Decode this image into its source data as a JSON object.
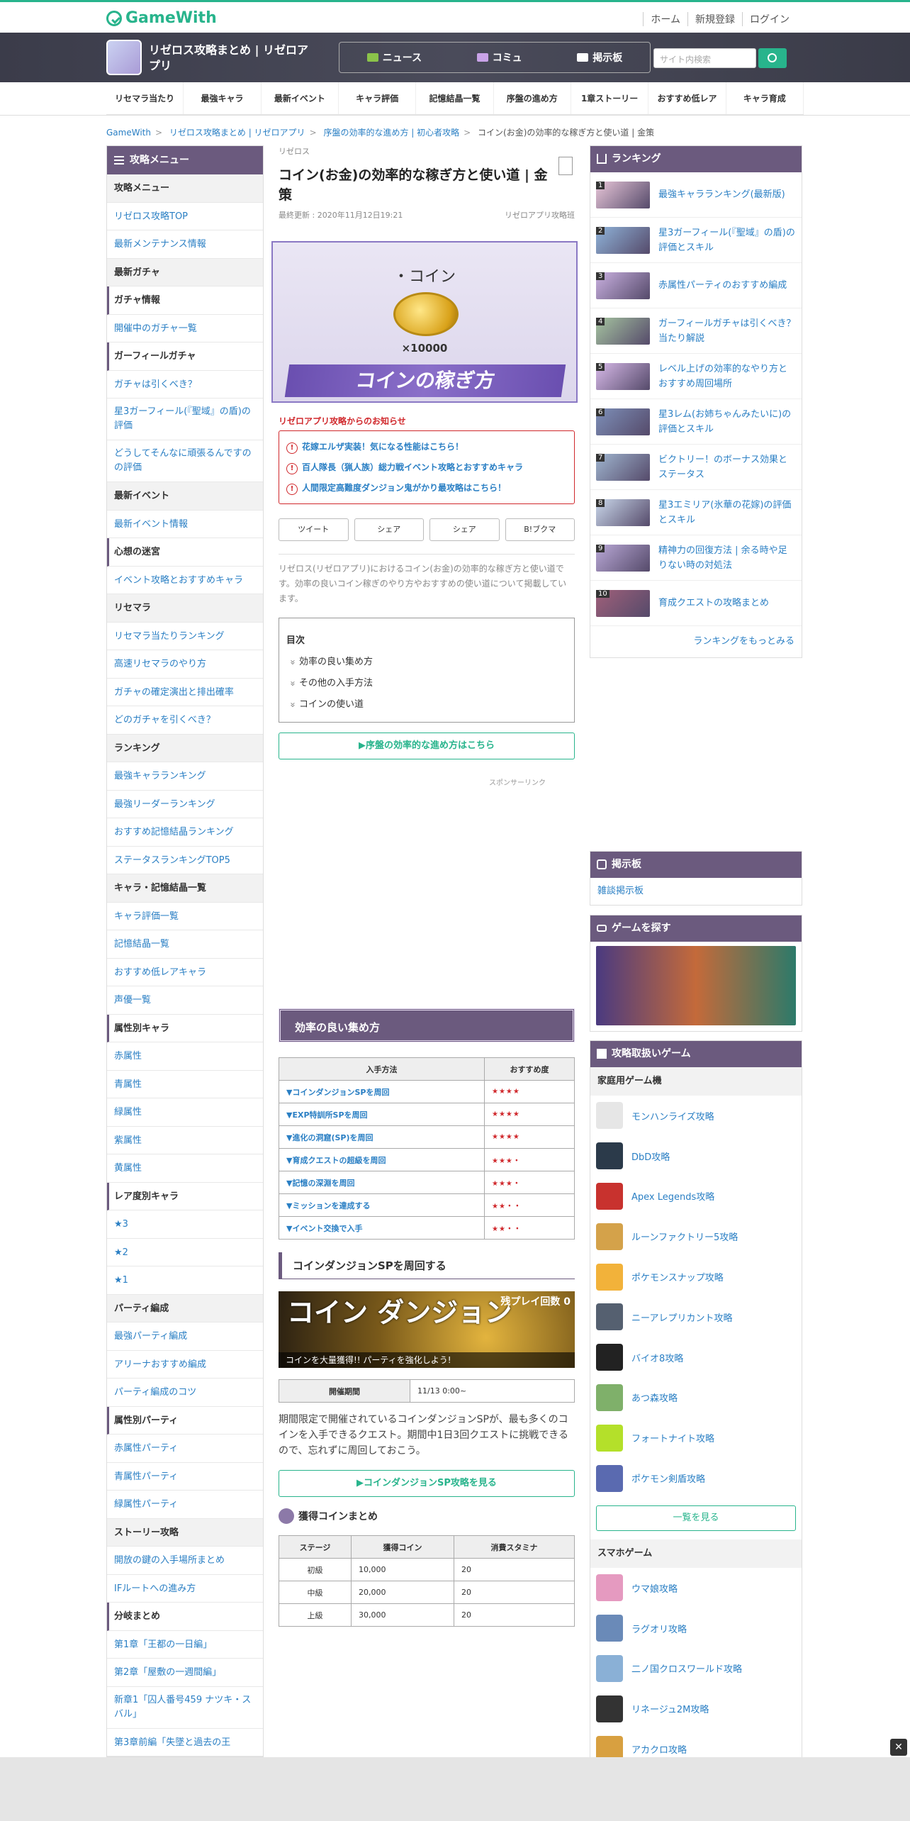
{
  "header": {
    "brand": "GameWith",
    "links": [
      "ホーム",
      "新規登録",
      "ログイン"
    ]
  },
  "hero": {
    "game_title": "リゼロス攻略まとめ | リゼロアプリ",
    "nav": [
      "ニュース",
      "コミュ",
      "掲示板"
    ],
    "search_placeholder": "サイト内検索"
  },
  "catnav": [
    "リセマラ当たり",
    "最強キャラ",
    "最新イベント",
    "キャラ評価",
    "記憶結晶一覧",
    "序盤の進め方",
    "1章ストーリー",
    "おすすめ低レア",
    "キャラ育成"
  ],
  "breadcrumb": [
    "GameWith",
    "リゼロス攻略まとめ | リゼロアプリ",
    "序盤の効率的な進め方 | 初心者攻略",
    "コイン(お金)の効率的な稼ぎ方と使い道 | 金策"
  ],
  "leftmenu": {
    "title": "攻略メニュー",
    "items": [
      {
        "t": "攻略メニュー",
        "k": "sec"
      },
      {
        "t": "リゼロス攻略TOP"
      },
      {
        "t": "最新メンテナンス情報"
      },
      {
        "t": "最新ガチャ",
        "k": "sec"
      },
      {
        "t": "ガチャ情報",
        "k": "sub"
      },
      {
        "t": "開催中のガチャ一覧"
      },
      {
        "t": "ガーフィールガチャ",
        "k": "sub"
      },
      {
        "t": "ガチャは引くべき？"
      },
      {
        "t": "星3ガーフィール(『聖域』の盾)の評価",
        "k": "two"
      },
      {
        "t": "どうしてそんなに頑張るんですの の評価",
        "k": "two"
      },
      {
        "t": "最新イベント",
        "k": "sec"
      },
      {
        "t": "最新イベント情報"
      },
      {
        "t": "心想の迷宮",
        "k": "sub"
      },
      {
        "t": "イベント攻略とおすすめキャラ"
      },
      {
        "t": "リセマラ",
        "k": "sec"
      },
      {
        "t": "リセマラ当たりランキング"
      },
      {
        "t": "高速リセマラのやり方"
      },
      {
        "t": "ガチャの確定演出と排出確率"
      },
      {
        "t": "どのガチャを引くべき？"
      },
      {
        "t": "ランキング",
        "k": "sec"
      },
      {
        "t": "最強キャラランキング"
      },
      {
        "t": "最強リーダーランキング"
      },
      {
        "t": "おすすめ記憶結晶ランキング"
      },
      {
        "t": "ステータスランキングTOP5"
      },
      {
        "t": "キャラ・記憶結晶一覧",
        "k": "sec"
      },
      {
        "t": "キャラ評価一覧"
      },
      {
        "t": "記憶結晶一覧"
      },
      {
        "t": "おすすめ低レアキャラ"
      },
      {
        "t": "声優一覧"
      },
      {
        "t": "属性別キャラ",
        "k": "sub"
      },
      {
        "t": "赤属性"
      },
      {
        "t": "青属性"
      },
      {
        "t": "緑属性"
      },
      {
        "t": "紫属性"
      },
      {
        "t": "黄属性"
      },
      {
        "t": "レア度別キャラ",
        "k": "sub"
      },
      {
        "t": "★3"
      },
      {
        "t": "★2"
      },
      {
        "t": "★1"
      },
      {
        "t": "パーティ編成",
        "k": "sec"
      },
      {
        "t": "最強パーティ編成"
      },
      {
        "t": "アリーナおすすめ編成"
      },
      {
        "t": "パーティ編成のコツ"
      },
      {
        "t": "属性別パーティ",
        "k": "sub"
      },
      {
        "t": "赤属性パーティ"
      },
      {
        "t": "青属性パーティ"
      },
      {
        "t": "緑属性パーティ"
      },
      {
        "t": "ストーリー攻略",
        "k": "sec"
      },
      {
        "t": "開放の鍵の入手場所まとめ"
      },
      {
        "t": "IFルートへの進み方"
      },
      {
        "t": "分岐まとめ",
        "k": "sub"
      },
      {
        "t": "第1章「王都の一日編」"
      },
      {
        "t": "第2章「屋敷の一週間編」"
      },
      {
        "t": "新章1「囚人番号459 ナツキ・スバル」",
        "k": "two"
      },
      {
        "t": "第3章前編「失墜と過去の王"
      }
    ]
  },
  "article": {
    "category": "リゼロス",
    "title": "コイン(お金)の効率的な稼ぎ方と使い道 | 金策",
    "updated": "最終更新 : 2020年11月12日19:21",
    "author": "リゼロアプリ攻略班",
    "banner": {
      "label": "・コイン",
      "mult": "×10000",
      "ribbon": "コインの稼ぎ方"
    },
    "notice_title": "リゼロアプリ攻略からのお知らせ",
    "notices": [
      "花嫁エルザ実装！気になる性能はこちら！",
      "百人隊長（猟人族）総力戦イベント攻略とおすすめキャラ",
      "人間限定高難度ダンジョン鬼がかり最攻略はこちら！"
    ],
    "share": [
      "ツイート",
      "シェア",
      "シェア",
      "B!ブクマ"
    ],
    "intro": "リゼロス(リゼロアプリ)におけるコイン(お金)の効率的な稼ぎ方と使い道です。効率の良いコイン稼ぎのやり方やおすすめの使い道について掲載しています。",
    "toc": {
      "title": "目次",
      "items": [
        "効率の良い集め方",
        "その他の入手方法",
        "コインの使い道"
      ]
    },
    "btn1": "▶序盤の効率的な進め方はこちら",
    "sponsor": "スポンサーリンク",
    "h2": "効率の良い集め方",
    "t1": {
      "headers": [
        "入手方法",
        "おすすめ度"
      ],
      "rows": [
        [
          "▼コインダンジョンSPを周回",
          "★★★★"
        ],
        [
          "▼EXP特訓所SPを周回",
          "★★★★"
        ],
        [
          "▼進化の洞窟(SP)を周回",
          "★★★★"
        ],
        [
          "▼育成クエストの超級を周回",
          "★★★・"
        ],
        [
          "▼記憶の深淵を周回",
          "★★★・"
        ],
        [
          "▼ミッションを達成する",
          "★★・・"
        ],
        [
          "▼イベント交換で入手",
          "★★・・"
        ]
      ]
    },
    "h3": "コインダンジョンSPを周回する",
    "csp": {
      "title": "コイン ダンジョン",
      "count": "残プレイ回数 0",
      "sub": "コインを大量獲得!! パーティを強化しよう!"
    },
    "t2": {
      "header": "開催期間",
      "value": "11/13 0:00~"
    },
    "p1": "期間限定で開催されているコインダンジョンSPが、最も多くのコインを入手できるクエスト。期間中1日3回クエストに挑戦できるので、忘れずに周回しておこう。",
    "btn2": "▶コインダンジョンSP攻略を見る",
    "h4": "獲得コインまとめ",
    "t3": {
      "headers": [
        "ステージ",
        "獲得コイン",
        "消費スタミナ"
      ],
      "rows": [
        [
          "初級",
          "10,000",
          "20"
        ],
        [
          "中級",
          "20,000",
          "20"
        ],
        [
          "上級",
          "30,000",
          "20"
        ]
      ]
    }
  },
  "ranking": {
    "title": "ランキング",
    "items": [
      "最強キャラランキング(最新版)",
      "星3ガーフィール(『聖域』の盾)の評価とスキル",
      "赤属性パーティのおすすめ編成",
      "ガーフィールガチャは引くべき？当たり解説",
      "レベル上げの効率的なやり方とおすすめ周回場所",
      "星3レム(お姉ちゃんみたいに)の評価とスキル",
      "ビクトリー！のボーナス効果とステータス",
      "星3エミリア(氷華の花嫁)の評価とスキル",
      "精神力の回復方法 | 余る時や足りない時の対処法",
      "育成クエストの攻略まとめ"
    ],
    "more": "ランキングをもっとみる"
  },
  "board": {
    "title": "掲示板",
    "link": "雑談掲示板"
  },
  "find": {
    "title": "ゲームを探す"
  },
  "games": {
    "title": "攻略取扱いゲーム",
    "sec1": "家庭用ゲーム機",
    "list1": [
      "モンハンライズ攻略",
      "DbD攻略",
      "Apex Legends攻略",
      "ルーンファクトリー5攻略",
      "ポケモンスナップ攻略",
      "ニーアレプリカント攻略",
      "バイオ8攻略",
      "あつ森攻略",
      "フォートナイト攻略",
      "ポケモン剣盾攻略"
    ],
    "more": "一覧を見る",
    "sec2": "スマホゲーム",
    "list2": [
      "ウマ娘攻略",
      "ラグオリ攻略",
      "二ノ国クロスワールド攻略",
      "リネージュ2M攻略",
      "アカクロ攻略"
    ]
  }
}
